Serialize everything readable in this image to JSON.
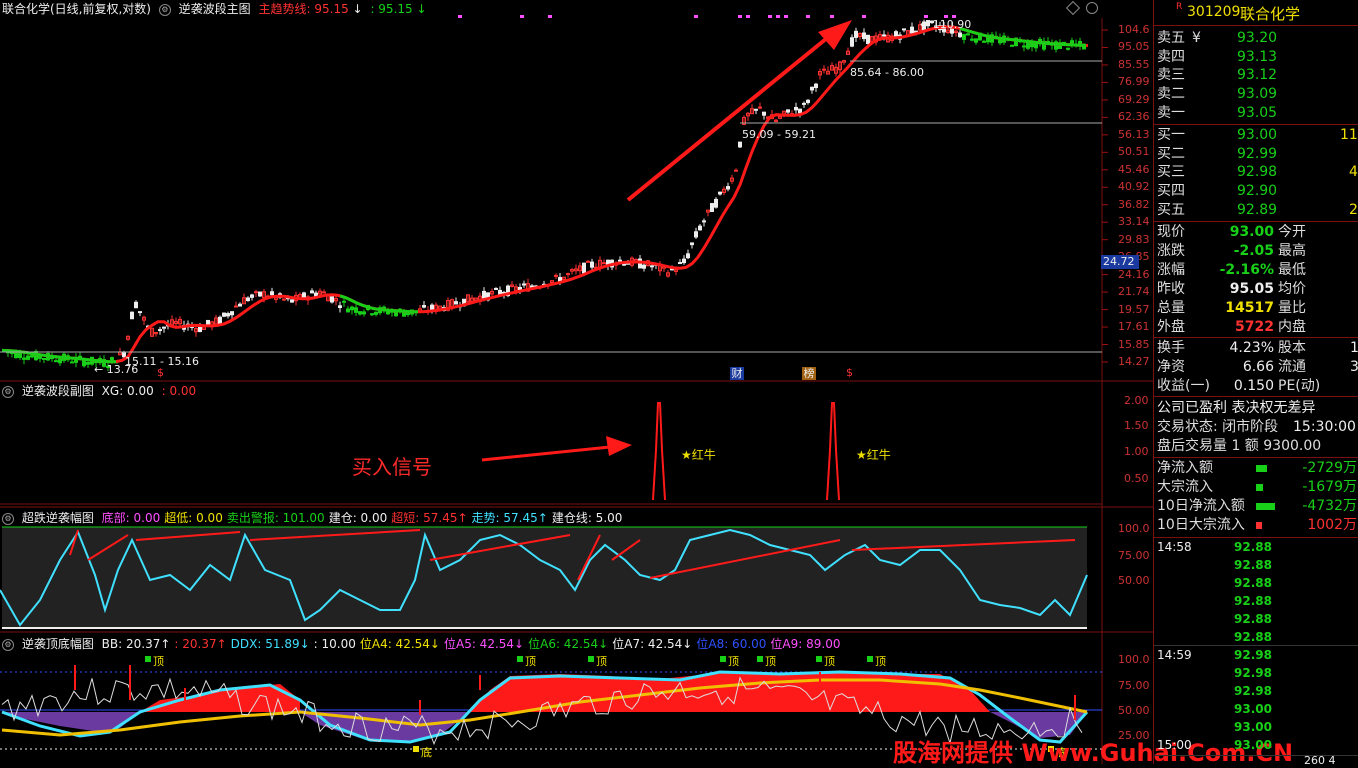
{
  "main_header": {
    "stock": "联合化学(日线,前复权,对数)",
    "indicator": "逆袭波段主图",
    "trend_label": "主趋势线: 95.15",
    "trend_arrow": "↓",
    "trend2": ": 95.15",
    "trend2_arrow": "↓"
  },
  "main_axis": [
    "104.6",
    "95.05",
    "85.55",
    "76.99",
    "69.29",
    "62.36",
    "56.13",
    "50.51",
    "45.46",
    "40.92",
    "36.82",
    "33.14",
    "29.83",
    "26.85",
    "24.16",
    "21.74",
    "19.57",
    "17.61",
    "15.85",
    "14.27"
  ],
  "current_price_tag": "24.72",
  "annotations": {
    "high": "← 110.90",
    "low": "← 13.76",
    "range1": "15.11 - 15.16",
    "range2": "59.09 - 59.21",
    "range3": "85.64 - 86.00"
  },
  "event_markers": [
    {
      "label": "财",
      "bg": "#1a3aa0"
    },
    {
      "label": "榜",
      "bg": "#a06010"
    },
    {
      "label": "$",
      "bg": "#000"
    },
    {
      "label": "$",
      "bg": "#000"
    }
  ],
  "sub1": {
    "title": "逆袭波段副图",
    "xg": "XG: 0.00",
    "v2": ": 0.00",
    "axis": [
      "2.00",
      "1.50",
      "1.00",
      "0.50"
    ],
    "signal_label": "买入信号",
    "marks": [
      "★红牛",
      "★红牛"
    ]
  },
  "sub2": {
    "title": "超跌逆袭幅图",
    "items": [
      {
        "t": "底部: 0.00",
        "c": "#ff50ff"
      },
      {
        "t": "超低: 0.00",
        "c": "#f0e000"
      },
      {
        "t": "卖出警报: 101.00",
        "c": "#18d018"
      },
      {
        "t": "建仓: 0.00",
        "c": "#eee"
      },
      {
        "t": "超短: 57.45↑",
        "c": "#ff3232"
      },
      {
        "t": "走势: 57.45↑",
        "c": "#40e0ff"
      },
      {
        "t": "建仓线: 5.00",
        "c": "#eee"
      }
    ],
    "axis": [
      "100.0",
      "75.00",
      "50.00"
    ]
  },
  "sub3": {
    "title": "逆袭顶底幅图",
    "items": [
      {
        "t": "BB: 20.37↑",
        "c": "#eee"
      },
      {
        "t": ": 20.37↑",
        "c": "#ff3232"
      },
      {
        "t": "DDX: 51.89↓",
        "c": "#40e0ff"
      },
      {
        "t": ": 10.00",
        "c": "#eee"
      },
      {
        "t": "位A4: 42.54↓",
        "c": "#f0e000"
      },
      {
        "t": "位A5: 42.54↓",
        "c": "#ff50ff"
      },
      {
        "t": "位A6: 42.54↓",
        "c": "#18d018"
      },
      {
        "t": "位A7: 42.54↓",
        "c": "#eee"
      },
      {
        "t": "位A8: 60.00",
        "c": "#3050ff"
      },
      {
        "t": "位A9: 89.00",
        "c": "#ff50ff"
      }
    ],
    "axis": [
      "100.0",
      "75.00",
      "50.00",
      "25.00"
    ],
    "top_label": "顶",
    "bottom_label": "底"
  },
  "quote": {
    "code": "301209",
    "name": "联合化学",
    "sells": [
      {
        "l": "卖五",
        "p": "93.20",
        "v": ""
      },
      {
        "l": "卖四",
        "p": "93.13",
        "v": ""
      },
      {
        "l": "卖三",
        "p": "93.12",
        "v": ""
      },
      {
        "l": "卖二",
        "p": "93.09",
        "v": ""
      },
      {
        "l": "卖一",
        "p": "93.05",
        "v": ""
      }
    ],
    "sell_unit": "¥",
    "buys": [
      {
        "l": "买一",
        "p": "93.00",
        "v": "11"
      },
      {
        "l": "买二",
        "p": "92.99",
        "v": ""
      },
      {
        "l": "买三",
        "p": "92.98",
        "v": "4"
      },
      {
        "l": "买四",
        "p": "92.90",
        "v": ""
      },
      {
        "l": "买五",
        "p": "92.89",
        "v": "2"
      }
    ],
    "stats": [
      {
        "l": "现价",
        "v": "93.00",
        "c": "green",
        "r": "今开"
      },
      {
        "l": "涨跌",
        "v": "-2.05",
        "c": "green",
        "r": "最高"
      },
      {
        "l": "涨幅",
        "v": "-2.16%",
        "c": "green",
        "r": "最低"
      },
      {
        "l": "昨收",
        "v": "95.05",
        "c": "white",
        "r": "均价"
      },
      {
        "l": "总量",
        "v": "14517",
        "c": "yellow",
        "r": "量比"
      },
      {
        "l": "外盘",
        "v": "5722",
        "c": "red",
        "r": "内盘"
      }
    ],
    "stats2": [
      {
        "l": "换手",
        "v": "4.23%",
        "c": "white",
        "r": "股本",
        "rv": "1"
      },
      {
        "l": "净资",
        "v": "6.66",
        "c": "white",
        "r": "流通",
        "rv": "3"
      },
      {
        "l": "收益(一)",
        "v": "0.150",
        "c": "white",
        "r": "PE(动)",
        "rv": ""
      }
    ],
    "notice": "公司已盈利 表决权无差异",
    "status_label": "交易状态: 闭市阶段",
    "status_time": "15:30:00",
    "after_hours": "盘后交易量 1 额 9300.00",
    "flows": [
      {
        "l": "净流入额",
        "v": "-2729万",
        "c": "green",
        "bar": 0.18
      },
      {
        "l": "大宗流入",
        "v": "-1679万",
        "c": "green",
        "bar": 0.12
      },
      {
        "l": "10日净流入额",
        "v": "-4732万",
        "c": "green",
        "bar": 0.32
      },
      {
        "l": "10日大宗流入",
        "v": "1002万",
        "c": "red",
        "bar": 0.05
      }
    ],
    "ticks": [
      {
        "t": "14:58",
        "p": "92.88"
      },
      {
        "t": "",
        "p": "92.88"
      },
      {
        "t": "",
        "p": "92.88"
      },
      {
        "t": "",
        "p": "92.88"
      },
      {
        "t": "",
        "p": "92.88"
      },
      {
        "t": "",
        "p": "92.88"
      },
      {
        "t": "14:59",
        "p": "92.98"
      },
      {
        "t": "",
        "p": "92.98"
      },
      {
        "t": "",
        "p": "92.98"
      },
      {
        "t": "",
        "p": "93.00"
      },
      {
        "t": "",
        "p": "93.00"
      },
      {
        "t": "15:00",
        "p": "93.00"
      }
    ],
    "last_tick_vol": "260 4"
  },
  "watermark": "股海网提供 Www.Guhai.Com.CN"
}
